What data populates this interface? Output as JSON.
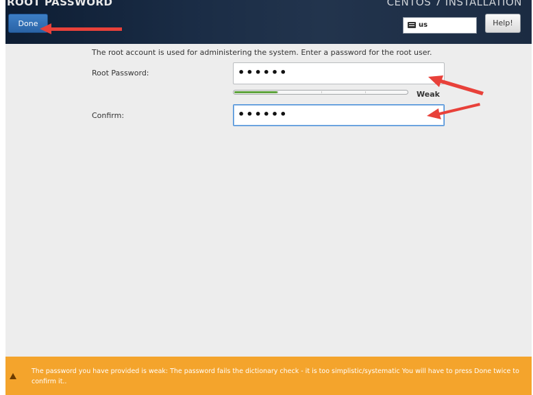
{
  "header": {
    "title": "ROOT PASSWORD",
    "product": "CENTOS 7 INSTALLATION",
    "done_label": "Done",
    "keyboard_layout": "us",
    "help_label": "Help!"
  },
  "form": {
    "description": "The root account is used for administering the system.  Enter a password for the root user.",
    "root_password_label": "Root Password:",
    "root_password_value": "••••••",
    "strength_label": "Weak",
    "strength_fraction": 0.25,
    "confirm_label": "Confirm:",
    "confirm_value": "••••••"
  },
  "warning": {
    "message": "The password you have provided is weak: The password fails the dictionary check - it is too simplistic/systematic You will have to press Done twice to confirm it.."
  },
  "colors": {
    "header_bg": "#1a2c45",
    "done_button": "#3272b8",
    "strength_bar": "#5da33b",
    "warning_bar": "#f4a42c",
    "annotation_arrow": "#e8413a"
  }
}
